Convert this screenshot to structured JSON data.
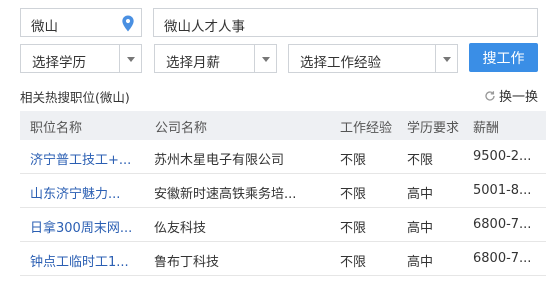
{
  "search": {
    "location": "微山",
    "keyword": "微山人才人事",
    "button_label": "搜工作"
  },
  "filters": {
    "education": "选择学历",
    "salary": "选择月薪",
    "experience": "选择工作经验"
  },
  "section": {
    "title": "相关热搜职位(微山)",
    "refresh_label": "换一换"
  },
  "table": {
    "headers": [
      "职位名称",
      "公司名称",
      "工作经验",
      "学历要求",
      "薪酬"
    ],
    "rows": [
      [
        "济宁普工技工+...",
        "苏州木星电子有限公司",
        "不限",
        "不限",
        "9500-2..."
      ],
      [
        "山东济宁魅力...",
        "安徽新时速高铁乘务培...",
        "不限",
        "高中",
        "5001-8..."
      ],
      [
        "日拿300周末网...",
        "仫友科技",
        "不限",
        "高中",
        "6800-7..."
      ],
      [
        "钟点工临时工1...",
        "鲁布丁科技",
        "不限",
        "高中",
        "6800-7..."
      ]
    ]
  },
  "colors": {
    "accent": "#3a8ee6",
    "link": "#2b5fb3",
    "header_bg": "#eef0f3"
  }
}
